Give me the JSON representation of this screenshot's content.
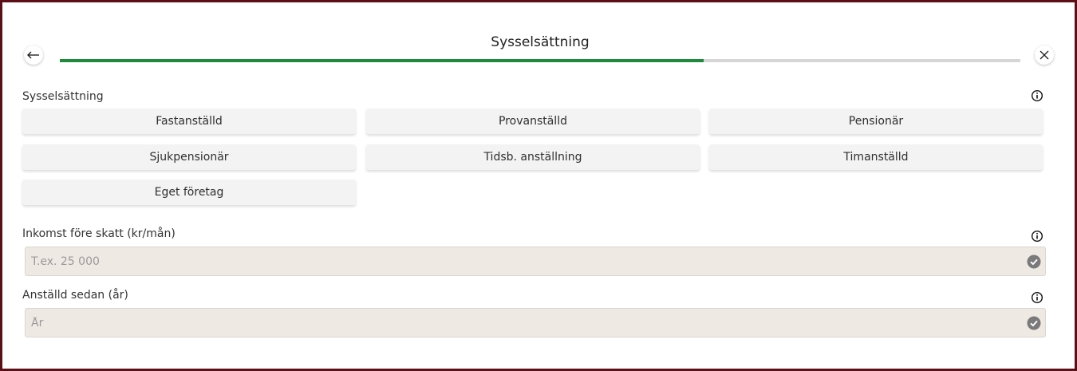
{
  "header": {
    "title": "Sysselsättning",
    "progress": 0.67,
    "back_icon": "arrow-left-icon",
    "close_icon": "close-icon"
  },
  "employment": {
    "label": "Sysselsättning",
    "options": [
      "Fastanställd",
      "Provanställd",
      "Pensionär",
      "Sjukpensionär",
      "Tidsb. anställning",
      "Timanställd",
      "Eget företag"
    ]
  },
  "income": {
    "label": "Inkomst före skatt (kr/mån)",
    "placeholder": "T.ex. 25 000",
    "value": ""
  },
  "employed_since": {
    "label": "Anställd sedan (år)",
    "placeholder": "År",
    "value": ""
  },
  "colors": {
    "progress": "#1e8a3c",
    "frame": "#5b0f16",
    "field_bg": "#efe9e4",
    "option_bg": "#f3f3f3"
  }
}
